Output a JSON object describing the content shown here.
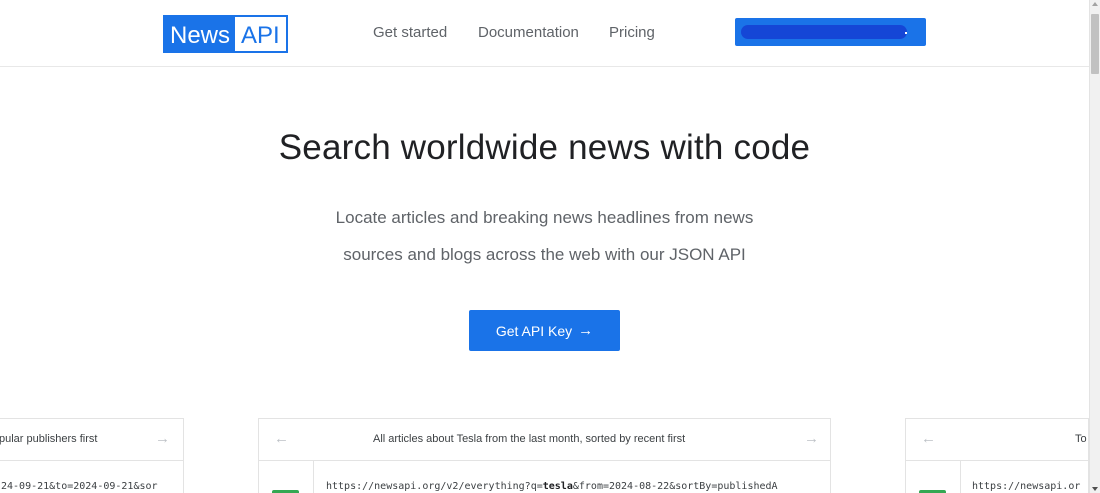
{
  "header": {
    "logo": {
      "part1": "News",
      "part2": "API"
    },
    "nav": [
      "Get started",
      "Documentation",
      "Pricing"
    ],
    "account_color": "#1a73e8"
  },
  "hero": {
    "title": "Search worldwide news with code",
    "subtitle_line1": "Locate articles and breaking news headlines from news",
    "subtitle_line2": "sources and blogs across the web with our JSON API",
    "cta_label": "Get API Key",
    "cta_icon": "arrow-right-icon"
  },
  "examples": [
    {
      "caption": "pular publishers first",
      "code_prefix": "24-09-21&to=2024-09-21&sor",
      "code_bold": ""
    },
    {
      "caption": "All articles about Tesla from the last month, sorted by recent first",
      "code_prefix": "https://newsapi.org/v2/everything?q=",
      "code_bold": "tesla",
      "code_suffix": "&from=2024-08-22&sortBy=publishedA"
    },
    {
      "caption": "To",
      "code_prefix": "https://newsapi.or",
      "code_bold": ""
    }
  ],
  "colors": {
    "brand": "#1a73e8",
    "method_badge": "#34a853"
  }
}
